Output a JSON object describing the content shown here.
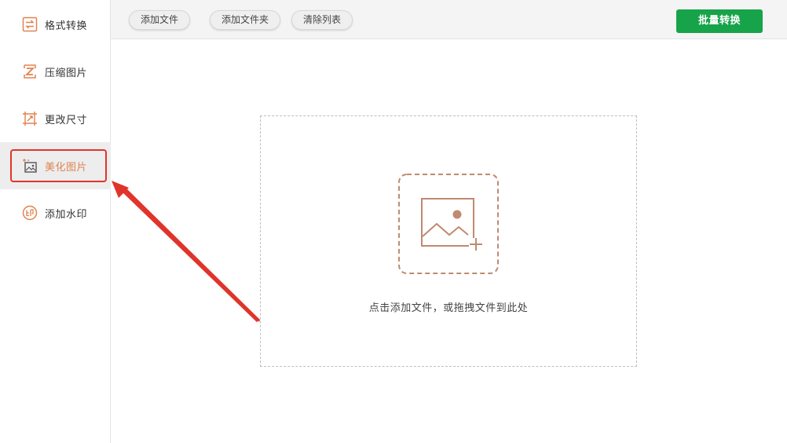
{
  "sidebar": {
    "items": [
      {
        "label": "格式转换",
        "icon": "format-convert-icon"
      },
      {
        "label": "压缩图片",
        "icon": "compress-image-icon"
      },
      {
        "label": "更改尺寸",
        "icon": "resize-icon"
      },
      {
        "label": "美化图片",
        "icon": "beautify-image-icon",
        "active": true
      },
      {
        "label": "添加水印",
        "icon": "watermark-icon"
      }
    ]
  },
  "toolbar": {
    "add_file": "添加文件",
    "add_folder": "添加文件夹",
    "clear_list": "清除列表",
    "batch_convert": "批量转换"
  },
  "dropzone": {
    "hint": "点击添加文件，或拖拽文件到此处",
    "icon": "image-add-icon"
  },
  "colors": {
    "accent": "#e08350",
    "primary_button": "#17a34a",
    "highlight": "#e0342a",
    "icon_brown": "#c08a70"
  }
}
